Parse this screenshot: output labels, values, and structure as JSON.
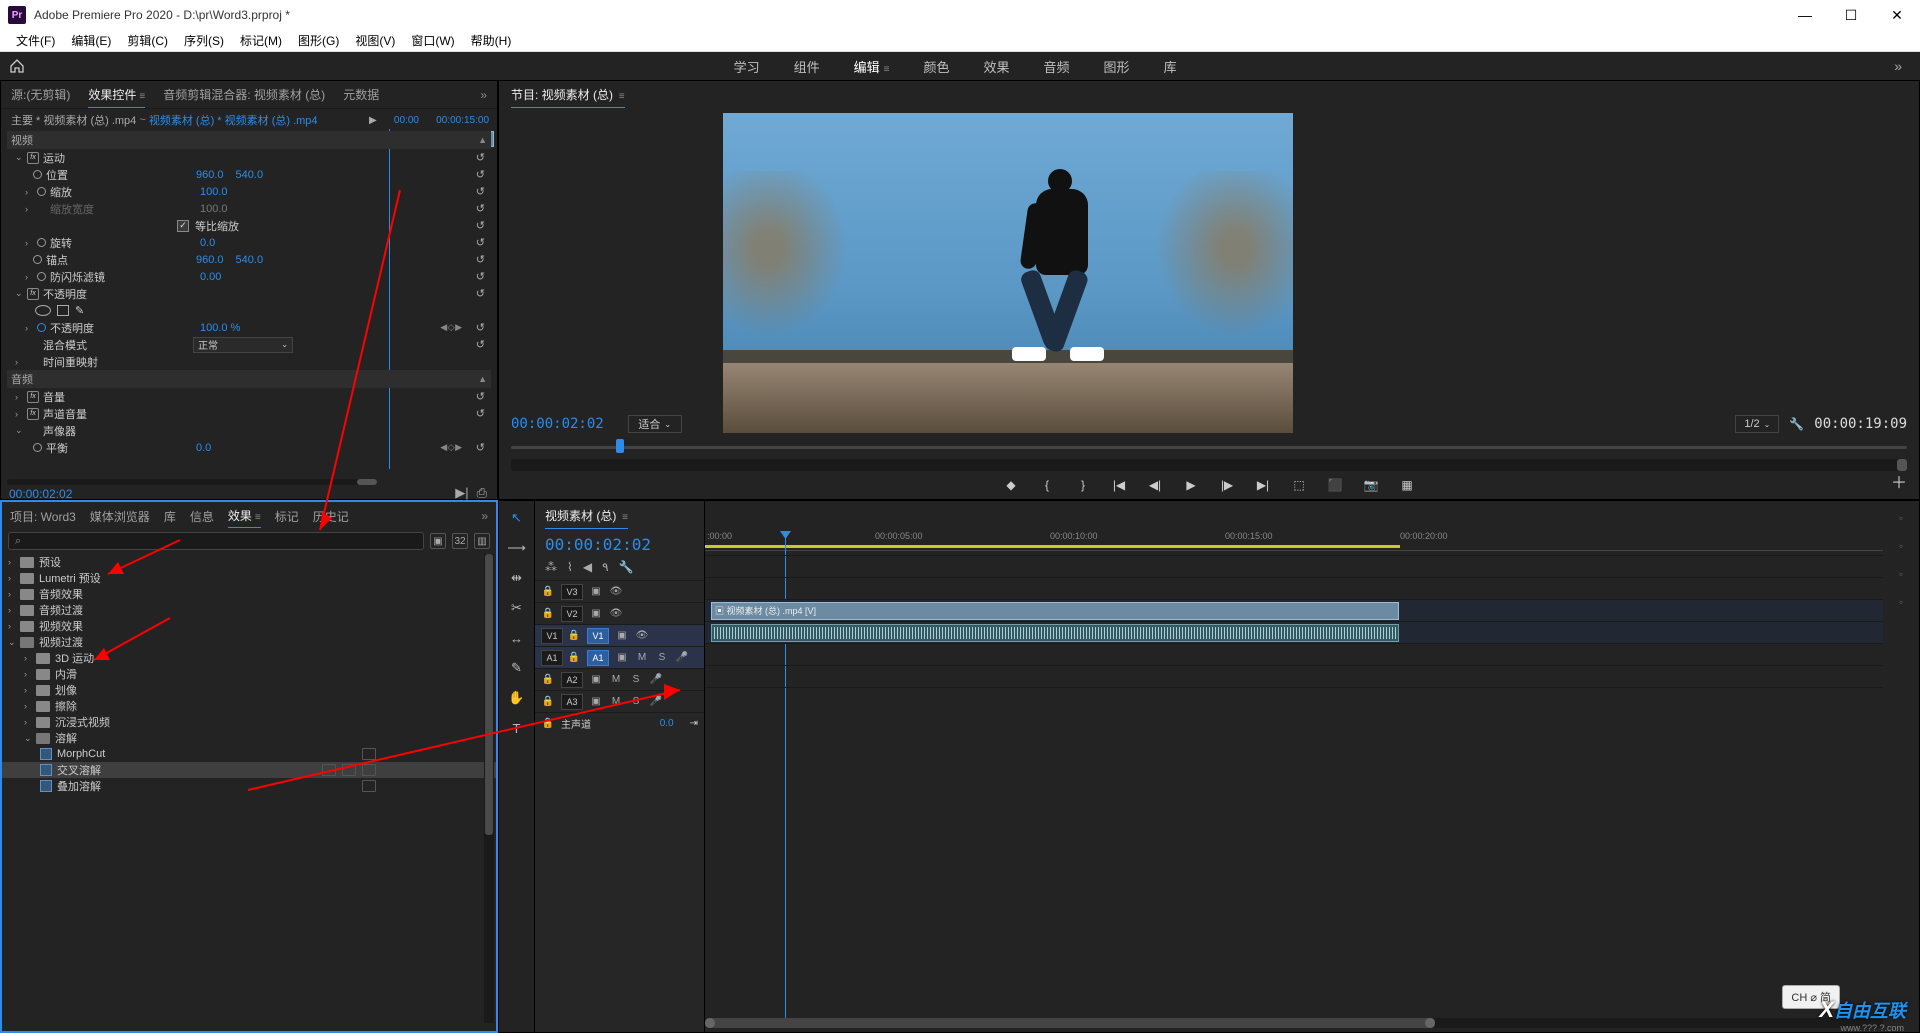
{
  "title_bar": {
    "app_name": "Adobe Premiere Pro 2020",
    "project_path": "D:\\pr\\Word3.prproj *",
    "logo_text": "Pr"
  },
  "menu_bar": [
    "文件(F)",
    "编辑(E)",
    "剪辑(C)",
    "序列(S)",
    "标记(M)",
    "图形(G)",
    "视图(V)",
    "窗口(W)",
    "帮助(H)"
  ],
  "workspace_bar": {
    "tabs": [
      "学习",
      "组件",
      "编辑",
      "颜色",
      "效果",
      "音频",
      "图形",
      "库"
    ],
    "active_index": 2
  },
  "source_panel": {
    "tabs": [
      "源:(无剪辑)",
      "效果控件",
      "音频剪辑混合器: 视频素材 (总)",
      "元数据"
    ],
    "active_index": 1,
    "clip_path_prefix": "主要 * 视频素材 (总) .mp4",
    "clip_path_sep": "~",
    "clip_path_link": "视频素材 (总) * 视频素材 (总) .mp4",
    "mini_tc_start": "00:00",
    "mini_tc_end": "00:00:15:00",
    "mini_clip_label": "视频素材 (总) .mp4",
    "sections": {
      "video_header": "视频",
      "motion": "运动",
      "position": {
        "label": "位置",
        "x": "960.0",
        "y": "540.0"
      },
      "scale": {
        "label": "缩放",
        "val": "100.0"
      },
      "scale_width": {
        "label": "缩放宽度",
        "val": "100.0"
      },
      "uniform": {
        "label": "等比缩放",
        "checked": true
      },
      "rotation": {
        "label": "旋转",
        "val": "0.0"
      },
      "anchor": {
        "label": "锚点",
        "x": "960.0",
        "y": "540.0"
      },
      "antiflicker": {
        "label": "防闪烁滤镜",
        "val": "0.00"
      },
      "opacity_header": "不透明度",
      "opacity": {
        "label": "不透明度",
        "val": "100.0 %"
      },
      "blend": {
        "label": "混合模式",
        "val": "正常"
      },
      "time_remap": "时间重映射",
      "audio_header": "音频",
      "volume": "音量",
      "ch_volume": "声道音量",
      "panner": "声像器",
      "balance": {
        "label": "平衡",
        "val": "0.0"
      }
    },
    "current_tc": "00:00:02:02"
  },
  "program_monitor": {
    "title": "节目: 视频素材 (总)",
    "tc_left": "00:00:02:02",
    "fit_label": "适合",
    "res_label": "1/2",
    "tc_right": "00:00:19:09"
  },
  "browser_panel": {
    "tabs": [
      "项目: Word3",
      "媒体浏览器",
      "库",
      "信息",
      "效果",
      "标记",
      "历史记"
    ],
    "active_index": 4,
    "search_placeholder": "",
    "tree": [
      {
        "type": "folder",
        "label": "预设",
        "open": false
      },
      {
        "type": "folder",
        "label": "Lumetri 预设",
        "open": false
      },
      {
        "type": "folder",
        "label": "音频效果",
        "open": false
      },
      {
        "type": "folder",
        "label": "音频过渡",
        "open": false
      },
      {
        "type": "folder",
        "label": "视频效果",
        "open": false
      },
      {
        "type": "folder",
        "label": "视频过渡",
        "open": true,
        "children": [
          {
            "type": "folder",
            "label": "3D 运动"
          },
          {
            "type": "folder",
            "label": "内滑"
          },
          {
            "type": "folder",
            "label": "划像"
          },
          {
            "type": "folder",
            "label": "擦除"
          },
          {
            "type": "folder",
            "label": "沉浸式视频"
          },
          {
            "type": "folder",
            "label": "溶解",
            "open": true,
            "children": [
              {
                "type": "fx",
                "label": "MorphCut",
                "badges": 1
              },
              {
                "type": "fx",
                "label": "交叉溶解",
                "selected": true,
                "badges": 3
              },
              {
                "type": "fx",
                "label": "叠加溶解",
                "badges": 1
              }
            ]
          }
        ]
      }
    ]
  },
  "timeline": {
    "seq_name": "视频素材 (总)",
    "tc": "00:00:02:02",
    "ruler_ticks": [
      ":00:00",
      "00:00:05:00",
      "00:00:10:00",
      "00:00:15:00",
      "00:00:20:00"
    ],
    "tracks_v": [
      "V3",
      "V2",
      "V1"
    ],
    "tracks_a": [
      "A1",
      "A2",
      "A3"
    ],
    "master_label": "主声道",
    "master_val": "0.0",
    "clip_label": "视频素材 (总) .mp4 [V]",
    "audio_meters": [
      "M",
      "S"
    ]
  },
  "ime": {
    "label": "CH ⌀ 简"
  },
  "watermark": {
    "brand": "自由互联",
    "sub_url": "www.??? ?.com"
  }
}
